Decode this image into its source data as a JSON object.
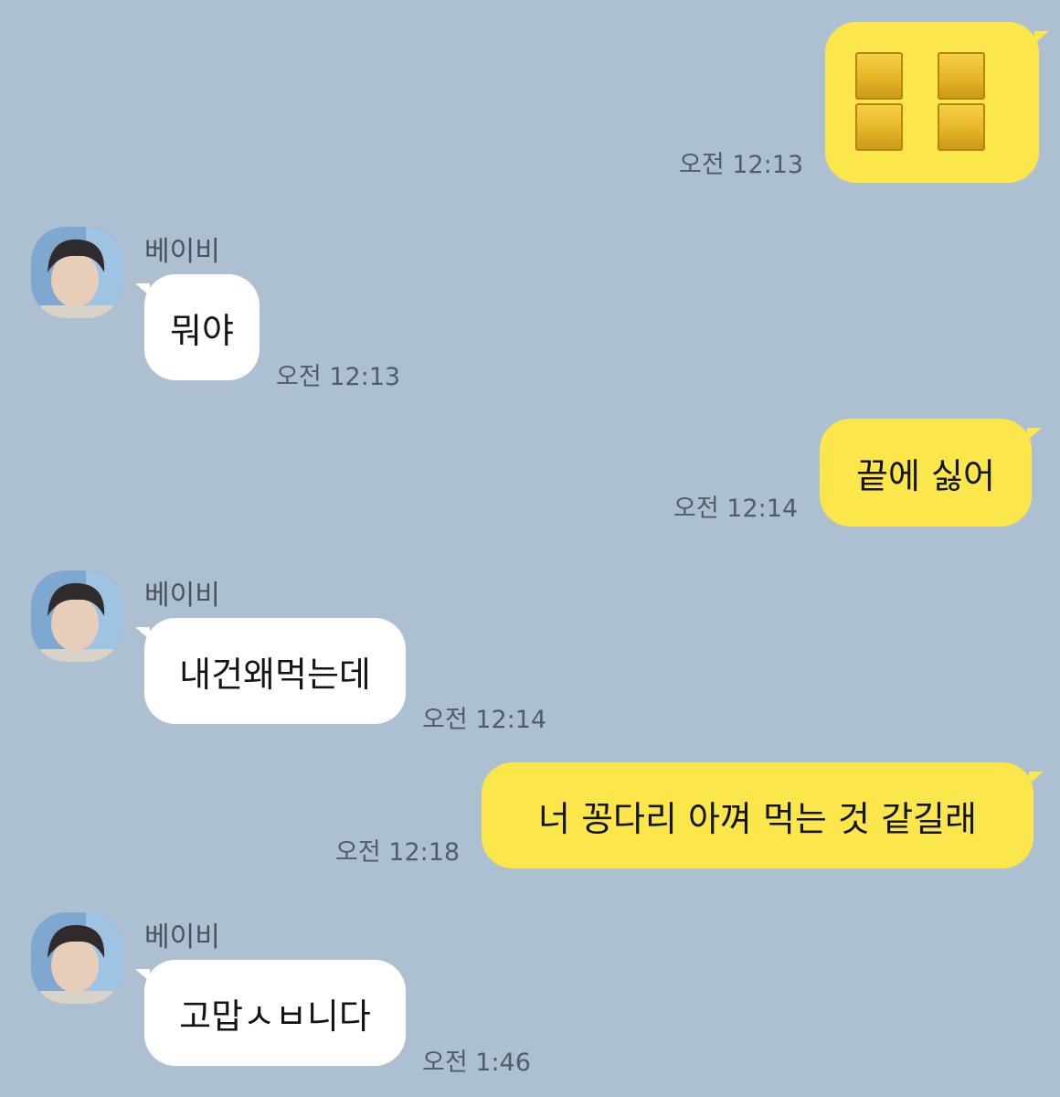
{
  "contact_name": "베이비",
  "messages": [
    {
      "side": "me",
      "text": "",
      "time": "오전 12:13",
      "is_emoji": true
    },
    {
      "side": "them",
      "sender": "베이비",
      "text": "뭐야",
      "time": "오전 12:13"
    },
    {
      "side": "me",
      "text": "끝에 싫어",
      "time": "오전 12:14"
    },
    {
      "side": "them",
      "sender": "베이비",
      "text": "내건왜먹는데",
      "time": "오전 12:14"
    },
    {
      "side": "me",
      "text": "너 꽁다리 아껴 먹는 것 같길래",
      "time": "오전 12:18"
    },
    {
      "side": "them",
      "sender": "베이비",
      "text": "고맙ㅅㅂ니다",
      "time": "오전 1:46"
    }
  ],
  "colors": {
    "background": "#adc0d1",
    "my_bubble": "#fbe64b",
    "their_bubble": "#ffffff",
    "time_text": "#535d67"
  },
  "icons": {
    "emoji": "yellow-block-emoji",
    "avatar": "contact-profile-photo"
  }
}
